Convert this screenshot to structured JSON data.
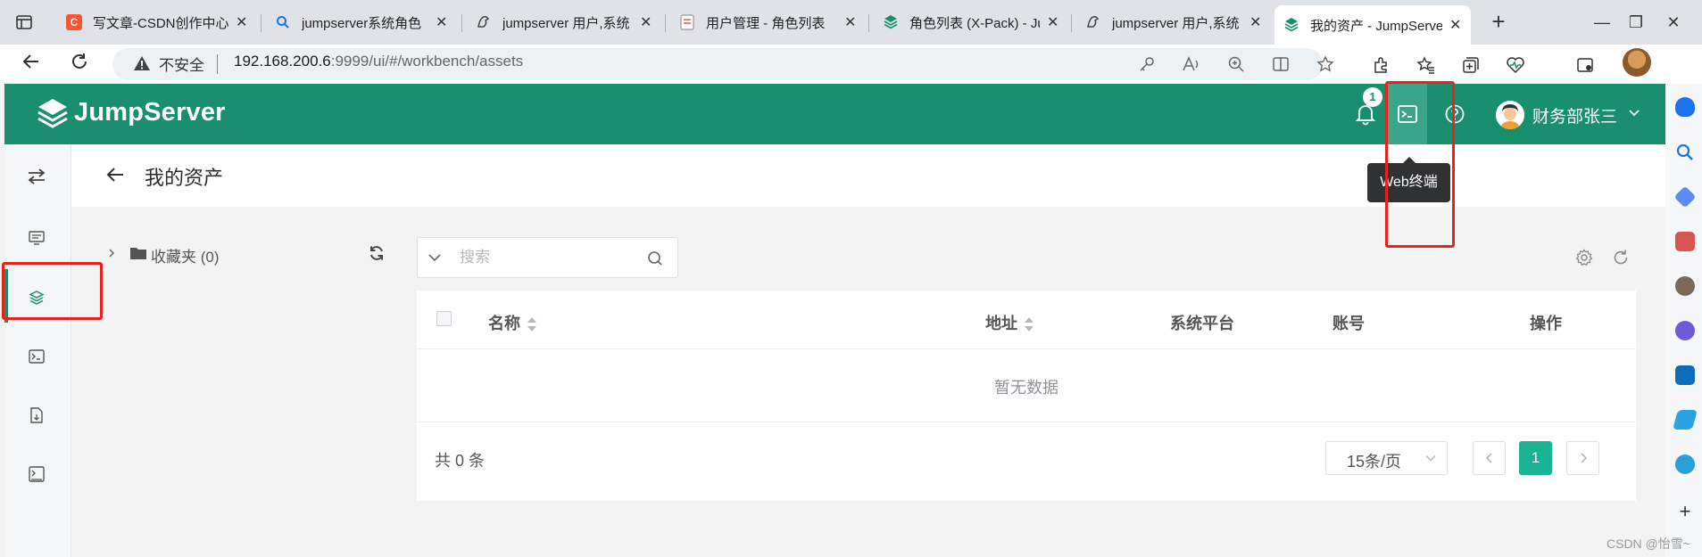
{
  "browser": {
    "tabs": [
      {
        "label": "写文章-CSDN创作中心",
        "favicon": "csdn-icon",
        "fav_char": "C",
        "fav_color": "#fc5531"
      },
      {
        "label": "jumpserver系统角色",
        "favicon": "search-icon",
        "fav_char": "",
        "fav_color": "#1a73e8"
      },
      {
        "label": "jumpserver 用户,系统",
        "favicon": "bird-icon",
        "fav_char": "",
        "fav_color": "#444444"
      },
      {
        "label": "用户管理 - 角色列表",
        "favicon": "doc-icon",
        "fav_char": "",
        "fav_color": "#e05a5a"
      },
      {
        "label": "角色列表 (X-Pack) - Ju",
        "favicon": "jumpserver-icon",
        "fav_char": "",
        "fav_color": "#1a8f70"
      },
      {
        "label": "jumpserver 用户,系统",
        "favicon": "bird-icon",
        "fav_char": "",
        "fav_color": "#444444"
      },
      {
        "label": "我的资产 - JumpServe",
        "favicon": "jumpserver-icon",
        "fav_char": "",
        "fav_color": "#1a8f70",
        "active": true
      }
    ],
    "address": {
      "insecure_label": "不安全",
      "url_host": "192.168.200.6",
      "url_rest": ":9999/ui/#/workbench/assets"
    }
  },
  "header": {
    "logo_text": "JumpServer",
    "notification_count": "1",
    "tooltip": "Web终端",
    "user_name": "财务部张三"
  },
  "page": {
    "title": "我的资产"
  },
  "tree": {
    "folder_label": "收藏夹 (0)"
  },
  "search": {
    "placeholder": "搜索"
  },
  "table": {
    "columns": [
      {
        "key": "name",
        "label": "名称",
        "sortable": true
      },
      {
        "key": "address",
        "label": "地址",
        "sortable": true
      },
      {
        "key": "platform",
        "label": "系统平台",
        "sortable": false
      },
      {
        "key": "account",
        "label": "账号",
        "sortable": false
      },
      {
        "key": "actions",
        "label": "操作",
        "sortable": false
      }
    ],
    "rows": [],
    "empty_text": "暂无数据"
  },
  "pagination": {
    "total_text": "共 0 条",
    "page_size": "15条/页",
    "current_page": "1"
  },
  "watermark": "CSDN @怡雪~",
  "colors": {
    "brand": "#1a8f70",
    "accent": "#1ab394",
    "annotation": "#e8231f"
  }
}
